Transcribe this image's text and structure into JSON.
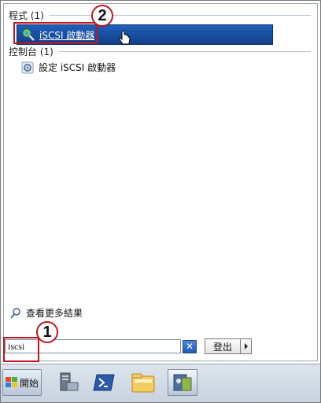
{
  "programs_group": {
    "header": "程式 (1)"
  },
  "control_panel_group": {
    "header": "控制台 (1)"
  },
  "results": {
    "program_item": "iSCSI 啟動器",
    "control_panel_item": "設定 iSCSI 啟動器"
  },
  "see_more": {
    "label": "查看更多結果"
  },
  "search": {
    "value": "iscsi"
  },
  "shutdown": {
    "label": "登出"
  },
  "taskbar": {
    "start_label": "開始"
  },
  "callouts": {
    "step1": "1",
    "step2": "2"
  },
  "colors": {
    "highlight": "#1f5fb8",
    "callout": "#c0161f"
  },
  "icons": [
    "magnifier-globe-icon",
    "control-panel-icon",
    "search-icon",
    "clear-icon",
    "windows-logo-icon",
    "server-manager-icon",
    "powershell-icon",
    "explorer-icon",
    "tools-icon"
  ]
}
